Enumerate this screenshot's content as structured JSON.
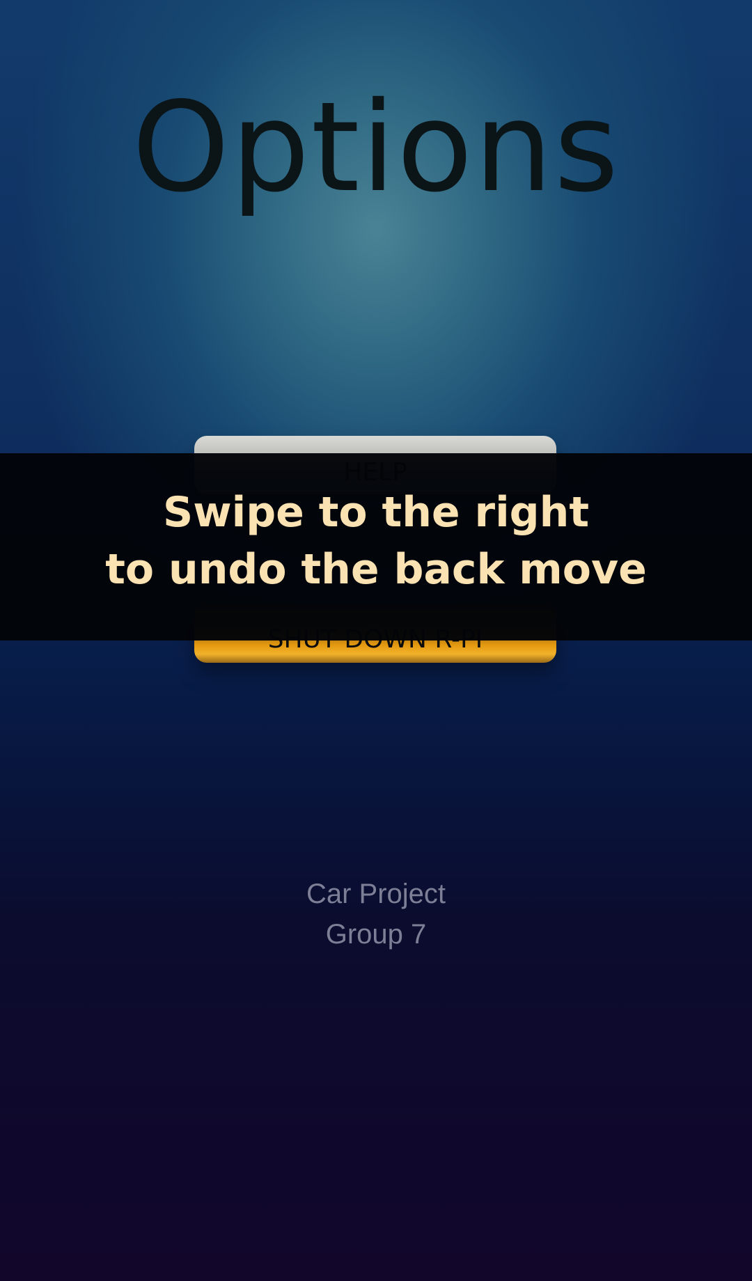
{
  "screen": {
    "title": "Options"
  },
  "buttons": {
    "help_label": "HELP",
    "shutdown_label": "SHUT DOWN  R-PI"
  },
  "toast": {
    "line1": "Swipe to the right",
    "line2": "to undo the back move"
  },
  "footer": {
    "line1": "Car Project",
    "line2": "Group 7"
  },
  "colors": {
    "help_button": "#bdbdba",
    "shutdown_button": "#e49a10",
    "toast_text": "#fbe2b3",
    "footer_text": "#7d7f96"
  }
}
